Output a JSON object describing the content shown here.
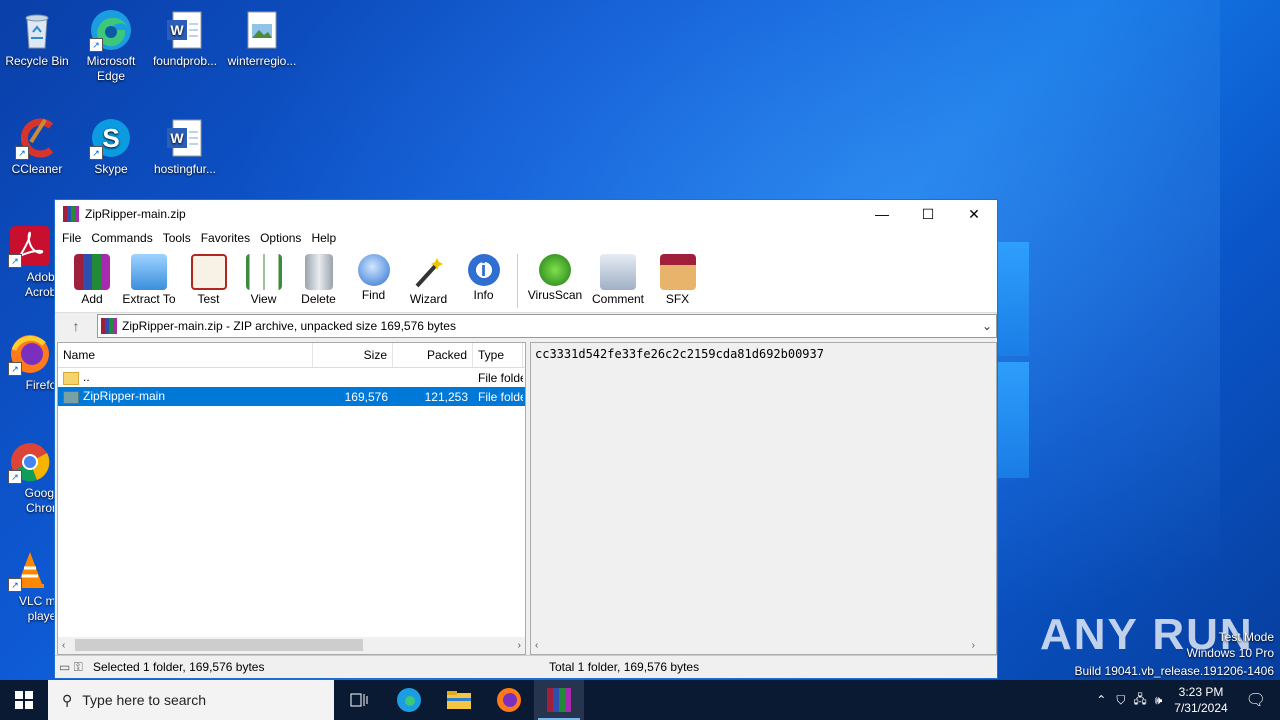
{
  "desktop": {
    "icons": [
      {
        "label": "Recycle Bin",
        "icon": "recycle-bin-icon"
      },
      {
        "label": "Microsoft Edge",
        "icon": "edge-icon"
      },
      {
        "label": "foundprob...",
        "icon": "word-doc-icon"
      },
      {
        "label": "winterregio...",
        "icon": "image-file-icon"
      },
      {
        "label": "CCleaner",
        "icon": "ccleaner-icon"
      },
      {
        "label": "Skype",
        "icon": "skype-icon"
      },
      {
        "label": "hostingfur...",
        "icon": "word-doc-icon"
      },
      {
        "label": "Adobe Acroba",
        "icon": "acrobat-icon"
      },
      {
        "label": "Firefox",
        "icon": "firefox-icon"
      },
      {
        "label": "Google Chrom",
        "icon": "chrome-icon"
      },
      {
        "label": "VLC med player",
        "icon": "vlc-icon"
      }
    ]
  },
  "window": {
    "title": "ZipRipper-main.zip",
    "minimize": "—",
    "maximize": "☐",
    "close": "✕",
    "menu": [
      "File",
      "Commands",
      "Tools",
      "Favorites",
      "Options",
      "Help"
    ],
    "toolbar": [
      {
        "label": "Add",
        "icon": "add-archive-icon"
      },
      {
        "label": "Extract To",
        "icon": "extract-folder-icon"
      },
      {
        "label": "Test",
        "icon": "test-clipboard-icon"
      },
      {
        "label": "View",
        "icon": "view-book-icon"
      },
      {
        "label": "Delete",
        "icon": "trash-icon"
      },
      {
        "label": "Find",
        "icon": "magnifier-icon"
      },
      {
        "label": "Wizard",
        "icon": "wand-icon"
      },
      {
        "label": "Info",
        "icon": "info-icon"
      },
      {
        "label": "VirusScan",
        "icon": "virus-scan-icon"
      },
      {
        "label": "Comment",
        "icon": "comment-icon"
      },
      {
        "label": "SFX",
        "icon": "sfx-box-icon"
      }
    ],
    "address": "ZipRipper-main.zip - ZIP archive, unpacked size 169,576 bytes",
    "columns": {
      "name": "Name",
      "size": "Size",
      "packed": "Packed",
      "type": "Type"
    },
    "rows": [
      {
        "name": "..",
        "size": "",
        "packed": "",
        "type": "File folde",
        "selected": false
      },
      {
        "name": "ZipRipper-main",
        "size": "169,576",
        "packed": "121,253",
        "type": "File folde",
        "selected": true
      }
    ],
    "comment": "cc3331d542fe33fe26c2c2159cda81d692b00937",
    "status_left": "Selected 1 folder, 169,576 bytes",
    "status_right": "Total 1 folder, 169,576 bytes"
  },
  "taskbar": {
    "search_placeholder": "Type here to search",
    "time": "3:23 PM",
    "date": "7/31/2024"
  },
  "watermark": {
    "brand": "ANY RUN",
    "line1": "Test Mode",
    "line2": "Windows 10 Pro",
    "line3": "Build 19041.vb_release.191206-1406"
  },
  "colors": {
    "accent": "#0078d7",
    "taskbar": "#0b1a33"
  }
}
